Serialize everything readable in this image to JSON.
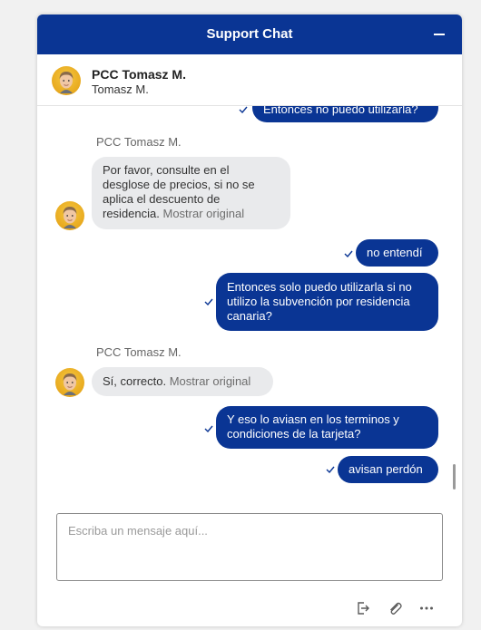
{
  "header": {
    "title": "Support Chat"
  },
  "agent": {
    "name": "PCC Tomasz M.",
    "subtitle": "Tomasz M."
  },
  "messages": {
    "partial_top": "Entonces no puedo utilizarla?",
    "sender_1": "PCC Tomasz M.",
    "agent_msg_1": {
      "lines": [
        "Por favor, consulte en el",
        "desglose de precios, si no se",
        "aplica el descuento de",
        "residencia."
      ],
      "show_original": "Mostrar original"
    },
    "user_msg_1": "no entendí",
    "user_msg_2": [
      "Entonces solo puedo utilizarla si no",
      "utilizo la subvención por residencia",
      "canaria?"
    ],
    "sender_2": "PCC Tomasz M.",
    "agent_msg_2": {
      "text": "Sí, correcto.",
      "show_original": "Mostrar original"
    },
    "user_msg_3": [
      "Y eso lo aviasn en los terminos y",
      "condiciones de la tarjeta?"
    ],
    "user_msg_4": "avisan perdón"
  },
  "composer": {
    "placeholder": "Escriba un mensaje aquí..."
  },
  "toolbar": {
    "icons": [
      "exit-icon",
      "paperclip-icon",
      "more-icon"
    ]
  },
  "colors": {
    "brand": "#0a3594",
    "agent_bubble": "#e9eaec",
    "show_original": "#6d6d6d"
  }
}
